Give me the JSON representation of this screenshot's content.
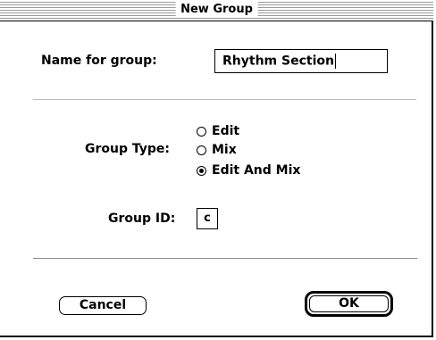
{
  "window": {
    "title": "New Group"
  },
  "name_field": {
    "label": "Name for group:",
    "value": "Rhythm Section"
  },
  "group_type": {
    "label": "Group Type:",
    "options": [
      {
        "label": "Edit",
        "selected": false
      },
      {
        "label": "Mix",
        "selected": false
      },
      {
        "label": "Edit And Mix",
        "selected": true
      }
    ]
  },
  "group_id": {
    "label": "Group ID:",
    "value": "c"
  },
  "buttons": {
    "cancel": "Cancel",
    "ok": "OK"
  }
}
